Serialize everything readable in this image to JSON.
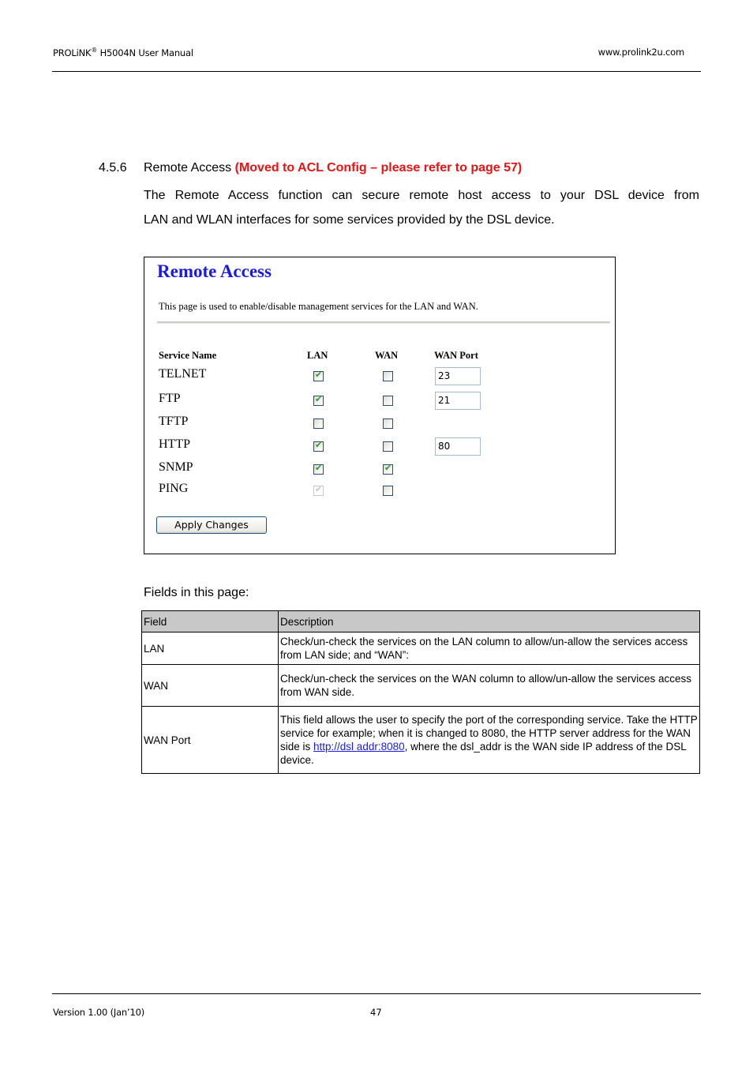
{
  "header": {
    "brand": "PROLiNK",
    "registered": "®",
    "manual_title": "H5004N User Manual",
    "website": "www.prolink2u.com"
  },
  "section": {
    "number": "4.5.6",
    "title": "Remote Access",
    "note": "(Moved to ACL Config – please refer to page 57)",
    "paragraph_line1": "The Remote Access function can secure remote host access to your DSL device from",
    "paragraph_line2": "LAN and WLAN interfaces for some services provided by the DSL device."
  },
  "screenshot": {
    "title": "Remote Access",
    "description": "This page is used to enable/disable management services for the LAN and WAN.",
    "columns": [
      "Service Name",
      "LAN",
      "WAN",
      "WAN Port"
    ],
    "services": [
      {
        "name": "TELNET",
        "lan": true,
        "wan": false,
        "wan_port": "23",
        "lan_disabled": false
      },
      {
        "name": "FTP",
        "lan": true,
        "wan": false,
        "wan_port": "21",
        "lan_disabled": false
      },
      {
        "name": "TFTP",
        "lan": false,
        "wan": false,
        "wan_port": null,
        "lan_disabled": false
      },
      {
        "name": "HTTP",
        "lan": true,
        "wan": false,
        "wan_port": "80",
        "lan_disabled": false
      },
      {
        "name": "SNMP",
        "lan": true,
        "wan": true,
        "wan_port": null,
        "lan_disabled": false
      },
      {
        "name": "PING",
        "lan": true,
        "wan": false,
        "wan_port": null,
        "lan_disabled": true
      }
    ],
    "apply_label": "Apply Changes"
  },
  "fields": {
    "label": "Fields in this page:",
    "header": {
      "field": "Field",
      "description": "Description"
    },
    "rows": [
      {
        "field": "LAN",
        "description": "Check/un-check the services on the LAN column to allow/un-allow the services access from LAN side; and “WAN”:"
      },
      {
        "field": "WAN",
        "description": "Check/un-check the services on the WAN column to allow/un-allow the services access from WAN side."
      },
      {
        "field": "WAN Port",
        "description_before": "This field allows the user to specify the port of the corresponding service. Take the HTTP service for example; when it is changed to 8080, the HTTP server address for the WAN side is ",
        "link": "http://dsl_addr:8080",
        "link_display": "http://dsl  addr:8080",
        "description_after": ", where the dsl_addr is the WAN side IP address of the DSL device."
      }
    ]
  },
  "footer": {
    "version": "Version 1.00 (Jan’10)",
    "page": "47"
  },
  "check_glyph": "✔"
}
